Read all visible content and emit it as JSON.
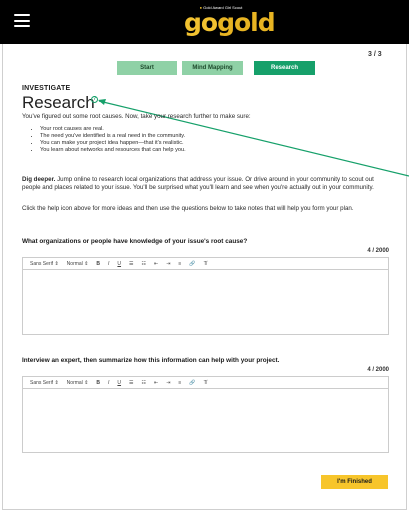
{
  "header": {
    "logo_tagline": "Gold Award Girl Scout",
    "logo_word_go": "go",
    "logo_word_gold": "gold",
    "menu_icon": "hamburger-icon"
  },
  "progress": {
    "counter": "3 / 3"
  },
  "steps": [
    {
      "label": "Start",
      "state": "complete"
    },
    {
      "label": "Mind Mapping",
      "state": "complete"
    },
    {
      "label": "Research",
      "state": "current"
    }
  ],
  "section": {
    "eyebrow": "INVESTIGATE",
    "title": "Research",
    "help_icon": "help-circle-icon",
    "intro": "You've figured out some root causes. Now, take your research further to make sure:",
    "bullets": [
      "Your root causes are real.",
      "The need you've identified is a real need in the community.",
      "You can make your project idea happen—that it's realistic.",
      "You learn about networks and resources that can help you."
    ],
    "para1_lead": "Dig deeper.",
    "para1_body": " Jump online to research local organizations that address your issue. Or drive around in your community to scout out people and places related to your issue. You'll be surprised what you'll learn and see when you're actually out in your community.",
    "para2": "Click the help icon above for more ideas and then use the questions below to take notes that will help you form your plan."
  },
  "questions": [
    {
      "prompt": "What organizations or people have knowledge of your issue's root cause?",
      "counter": "4 / 2000"
    },
    {
      "prompt": "Interview an expert, then summarize how this information can help with your project.",
      "counter": "4 / 2000"
    }
  ],
  "editor_toolbar": {
    "font": "Sans Serif",
    "size": "Normal",
    "dropdown_arrow": "⇕",
    "bold": "B",
    "italic": "I",
    "underline": "U",
    "ordered_list": "☰",
    "bullet_list": "☷",
    "outdent": "⇤",
    "indent": "⇥",
    "align": "≡",
    "link": "🔗",
    "clear_format": "T̸"
  },
  "actions": {
    "finish": "I'm Finished"
  },
  "colors": {
    "topbar": "#000000",
    "brand_gold": "#f2c230",
    "step_done": "#8fd1a6",
    "step_current": "#16a06a",
    "finish_button": "#f7c52b",
    "annotation_arrow": "#16a06a"
  }
}
